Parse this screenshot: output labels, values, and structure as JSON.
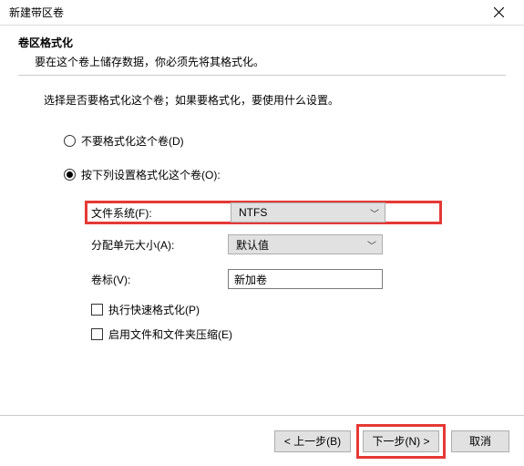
{
  "window": {
    "title": "新建带区卷"
  },
  "header": {
    "section_title": "卷区格式化",
    "section_desc": "要在这个卷上储存数据，你必须先将其格式化。"
  },
  "instruction": "选择是否要格式化这个卷；如果要格式化，要使用什么设置。",
  "radios": {
    "no_format": "不要格式化这个卷(D)",
    "do_format": "按下列设置格式化这个卷(O):"
  },
  "form": {
    "filesystem_label": "文件系统(F):",
    "filesystem_value": "NTFS",
    "alloc_label": "分配单元大小(A):",
    "alloc_value": "默认值",
    "vollabel_label": "卷标(V):",
    "vollabel_value": "新加卷"
  },
  "checks": {
    "quick_format": "执行快速格式化(P)",
    "compression": "启用文件和文件夹压缩(E)"
  },
  "buttons": {
    "back": "< 上一步(B)",
    "next": "下一步(N) >",
    "cancel": "取消"
  }
}
